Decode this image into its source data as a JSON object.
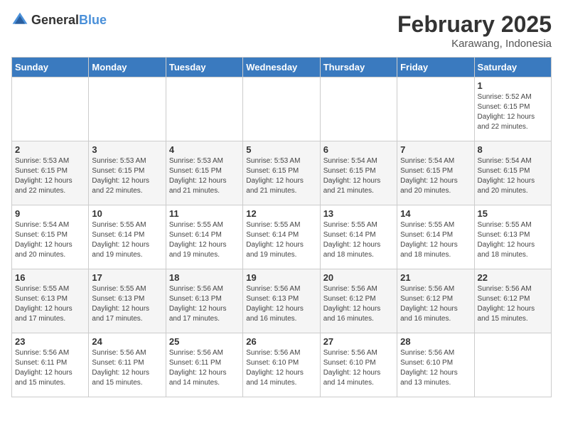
{
  "header": {
    "logo_general": "General",
    "logo_blue": "Blue",
    "month_title": "February 2025",
    "location": "Karawang, Indonesia"
  },
  "days_of_week": [
    "Sunday",
    "Monday",
    "Tuesday",
    "Wednesday",
    "Thursday",
    "Friday",
    "Saturday"
  ],
  "weeks": [
    [
      {
        "day": "",
        "info": ""
      },
      {
        "day": "",
        "info": ""
      },
      {
        "day": "",
        "info": ""
      },
      {
        "day": "",
        "info": ""
      },
      {
        "day": "",
        "info": ""
      },
      {
        "day": "",
        "info": ""
      },
      {
        "day": "1",
        "info": "Sunrise: 5:52 AM\nSunset: 6:15 PM\nDaylight: 12 hours\nand 22 minutes."
      }
    ],
    [
      {
        "day": "2",
        "info": "Sunrise: 5:53 AM\nSunset: 6:15 PM\nDaylight: 12 hours\nand 22 minutes."
      },
      {
        "day": "3",
        "info": "Sunrise: 5:53 AM\nSunset: 6:15 PM\nDaylight: 12 hours\nand 22 minutes."
      },
      {
        "day": "4",
        "info": "Sunrise: 5:53 AM\nSunset: 6:15 PM\nDaylight: 12 hours\nand 21 minutes."
      },
      {
        "day": "5",
        "info": "Sunrise: 5:53 AM\nSunset: 6:15 PM\nDaylight: 12 hours\nand 21 minutes."
      },
      {
        "day": "6",
        "info": "Sunrise: 5:54 AM\nSunset: 6:15 PM\nDaylight: 12 hours\nand 21 minutes."
      },
      {
        "day": "7",
        "info": "Sunrise: 5:54 AM\nSunset: 6:15 PM\nDaylight: 12 hours\nand 20 minutes."
      },
      {
        "day": "8",
        "info": "Sunrise: 5:54 AM\nSunset: 6:15 PM\nDaylight: 12 hours\nand 20 minutes."
      }
    ],
    [
      {
        "day": "9",
        "info": "Sunrise: 5:54 AM\nSunset: 6:15 PM\nDaylight: 12 hours\nand 20 minutes."
      },
      {
        "day": "10",
        "info": "Sunrise: 5:55 AM\nSunset: 6:14 PM\nDaylight: 12 hours\nand 19 minutes."
      },
      {
        "day": "11",
        "info": "Sunrise: 5:55 AM\nSunset: 6:14 PM\nDaylight: 12 hours\nand 19 minutes."
      },
      {
        "day": "12",
        "info": "Sunrise: 5:55 AM\nSunset: 6:14 PM\nDaylight: 12 hours\nand 19 minutes."
      },
      {
        "day": "13",
        "info": "Sunrise: 5:55 AM\nSunset: 6:14 PM\nDaylight: 12 hours\nand 18 minutes."
      },
      {
        "day": "14",
        "info": "Sunrise: 5:55 AM\nSunset: 6:14 PM\nDaylight: 12 hours\nand 18 minutes."
      },
      {
        "day": "15",
        "info": "Sunrise: 5:55 AM\nSunset: 6:13 PM\nDaylight: 12 hours\nand 18 minutes."
      }
    ],
    [
      {
        "day": "16",
        "info": "Sunrise: 5:55 AM\nSunset: 6:13 PM\nDaylight: 12 hours\nand 17 minutes."
      },
      {
        "day": "17",
        "info": "Sunrise: 5:55 AM\nSunset: 6:13 PM\nDaylight: 12 hours\nand 17 minutes."
      },
      {
        "day": "18",
        "info": "Sunrise: 5:56 AM\nSunset: 6:13 PM\nDaylight: 12 hours\nand 17 minutes."
      },
      {
        "day": "19",
        "info": "Sunrise: 5:56 AM\nSunset: 6:13 PM\nDaylight: 12 hours\nand 16 minutes."
      },
      {
        "day": "20",
        "info": "Sunrise: 5:56 AM\nSunset: 6:12 PM\nDaylight: 12 hours\nand 16 minutes."
      },
      {
        "day": "21",
        "info": "Sunrise: 5:56 AM\nSunset: 6:12 PM\nDaylight: 12 hours\nand 16 minutes."
      },
      {
        "day": "22",
        "info": "Sunrise: 5:56 AM\nSunset: 6:12 PM\nDaylight: 12 hours\nand 15 minutes."
      }
    ],
    [
      {
        "day": "23",
        "info": "Sunrise: 5:56 AM\nSunset: 6:11 PM\nDaylight: 12 hours\nand 15 minutes."
      },
      {
        "day": "24",
        "info": "Sunrise: 5:56 AM\nSunset: 6:11 PM\nDaylight: 12 hours\nand 15 minutes."
      },
      {
        "day": "25",
        "info": "Sunrise: 5:56 AM\nSunset: 6:11 PM\nDaylight: 12 hours\nand 14 minutes."
      },
      {
        "day": "26",
        "info": "Sunrise: 5:56 AM\nSunset: 6:10 PM\nDaylight: 12 hours\nand 14 minutes."
      },
      {
        "day": "27",
        "info": "Sunrise: 5:56 AM\nSunset: 6:10 PM\nDaylight: 12 hours\nand 14 minutes."
      },
      {
        "day": "28",
        "info": "Sunrise: 5:56 AM\nSunset: 6:10 PM\nDaylight: 12 hours\nand 13 minutes."
      },
      {
        "day": "",
        "info": ""
      }
    ]
  ]
}
